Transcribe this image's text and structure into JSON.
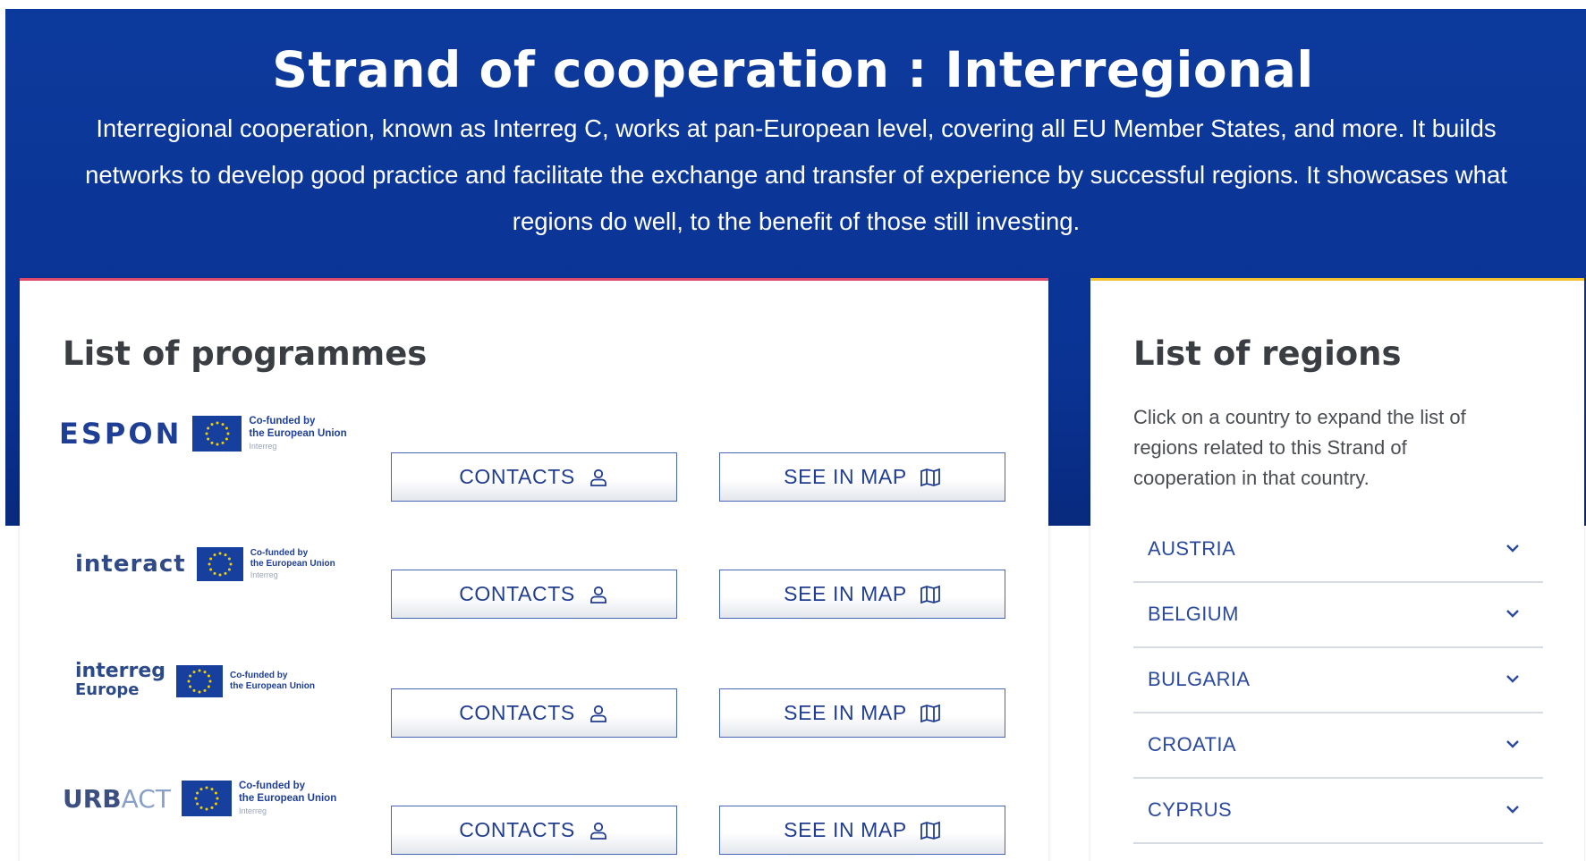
{
  "header": {
    "title": "Strand of cooperation : Interregional",
    "description": "Interregional cooperation, known as Interreg C, works at pan-European level, covering all EU Member States, and more. It builds networks to develop good practice and facilitate the exchange and transfer of experience by successful regions. It showcases what regions do well, to the benefit of those still investing."
  },
  "programmes": {
    "title": "List of programmes",
    "cofund_line1": "Co-funded by",
    "cofund_line2": "the European Union",
    "cofund_line3": "Interreg",
    "contacts_label": "CONTACTS",
    "map_label": "SEE IN MAP",
    "items": [
      {
        "name": "ESPON"
      },
      {
        "name": "interact"
      },
      {
        "name_line1": "interreg",
        "name_line2": "Europe"
      },
      {
        "name_a": "URB",
        "name_b": "ACT"
      }
    ]
  },
  "regions": {
    "title": "List of regions",
    "help": "Click on a country to expand the list of regions related to this Strand of cooperation in that country.",
    "items": [
      "AUSTRIA",
      "BELGIUM",
      "BULGARIA",
      "CROATIA",
      "CYPRUS"
    ]
  },
  "icons": {
    "contacts": "person-icon",
    "map": "map-icon",
    "expand": "chevron-down-icon",
    "eu": "eu-flag-icon"
  },
  "colors": {
    "hero_bg": "#0c3a9c",
    "button_text": "#213d8f",
    "region_text": "#2b4a9e",
    "programmes_accent": "#e04a6c",
    "regions_accent": "#f2c230"
  }
}
